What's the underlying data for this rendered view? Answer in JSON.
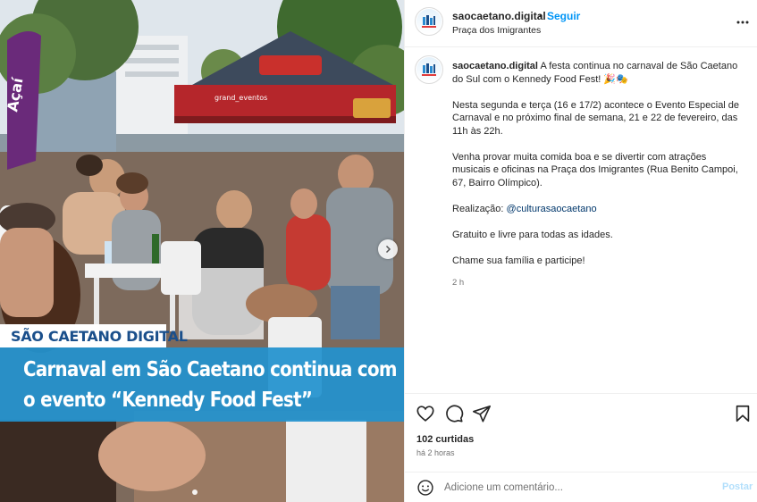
{
  "post": {
    "username": "saocaetano.digital",
    "separator": "•",
    "follow_label": "Seguir",
    "location": "Praça dos Imigrantes",
    "caption_intro": "A festa continua no carnaval de São Caetano do Sul com o Kennedy Food Fest! 🎉🎭",
    "caption_p1": "Nesta segunda e terça (16 e 17/2) acontece o Evento Especial de Carnaval e no próximo final de semana, 21 e 22 de fevereiro, das 11h às 22h.",
    "caption_p2": "Venha provar muita comida boa e se divertir com atrações musicais e oficinas na Praça dos Imigrantes (Rua Benito Campoi, 67, Bairro Olímpico).",
    "realizacao_label": "Realização:",
    "realizacao_mention": "@culturasaocaetano",
    "caption_p4": "Gratuito e livre para todas as idades.",
    "caption_p5": "Chame sua família e participe!",
    "caption_time": "2 h",
    "likes": "102 curtidas",
    "time_ago": "há 2 horas"
  },
  "image": {
    "brand": "SÃO CAETANO DIGITAL",
    "headline_line1": "Carnaval em São Caetano continua com",
    "headline_line2": "o evento “Kennedy Food Fest”",
    "tent_sign": "grand_eventos",
    "banner_text": "Açaí"
  },
  "comment": {
    "placeholder": "Adicione um comentário...",
    "post_label": "Postar"
  },
  "icons": {
    "avatar": "saocaetano-logo-icon",
    "more": "more-options-icon",
    "like": "heart-icon",
    "comment": "comment-bubble-icon",
    "share": "paper-plane-icon",
    "save": "bookmark-icon",
    "emoji": "smiley-icon",
    "next": "chevron-right-icon"
  },
  "colors": {
    "accent": "#0095f6",
    "headline_bg": "#2292cf",
    "brand_text": "#1a4f8b",
    "tent_red": "#b5262b"
  }
}
